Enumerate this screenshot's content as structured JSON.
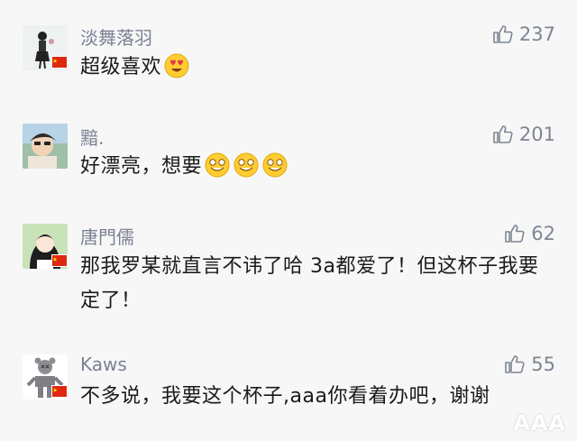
{
  "comments": [
    {
      "name": "淡舞落羽",
      "text": "超级喜欢",
      "likes": "237",
      "emoji": [
        "heart-eyes"
      ],
      "flag": true
    },
    {
      "name": "黯.",
      "text": "好漂亮，想要",
      "likes": "201",
      "emoji": [
        "grin",
        "grin",
        "grin"
      ],
      "flag": false
    },
    {
      "name": "唐門儒",
      "text": "那我罗某就直言不讳了哈  3a都爱了！但这杯子我要定了！",
      "likes": "62",
      "emoji": [],
      "flag": true
    },
    {
      "name": "Kaws",
      "text": "不多说，我要这个杯子,aaa你看着办吧，谢谢",
      "likes": "55",
      "emoji": [],
      "flag": true
    }
  ],
  "icons": {
    "like": "thumbs-up-icon",
    "flag": "china-flag-icon"
  },
  "colors": {
    "name": "#7a8294",
    "text": "#1a1a1a",
    "like": "#7d8593",
    "background": "#f7f7f7"
  },
  "watermark": "AAA"
}
